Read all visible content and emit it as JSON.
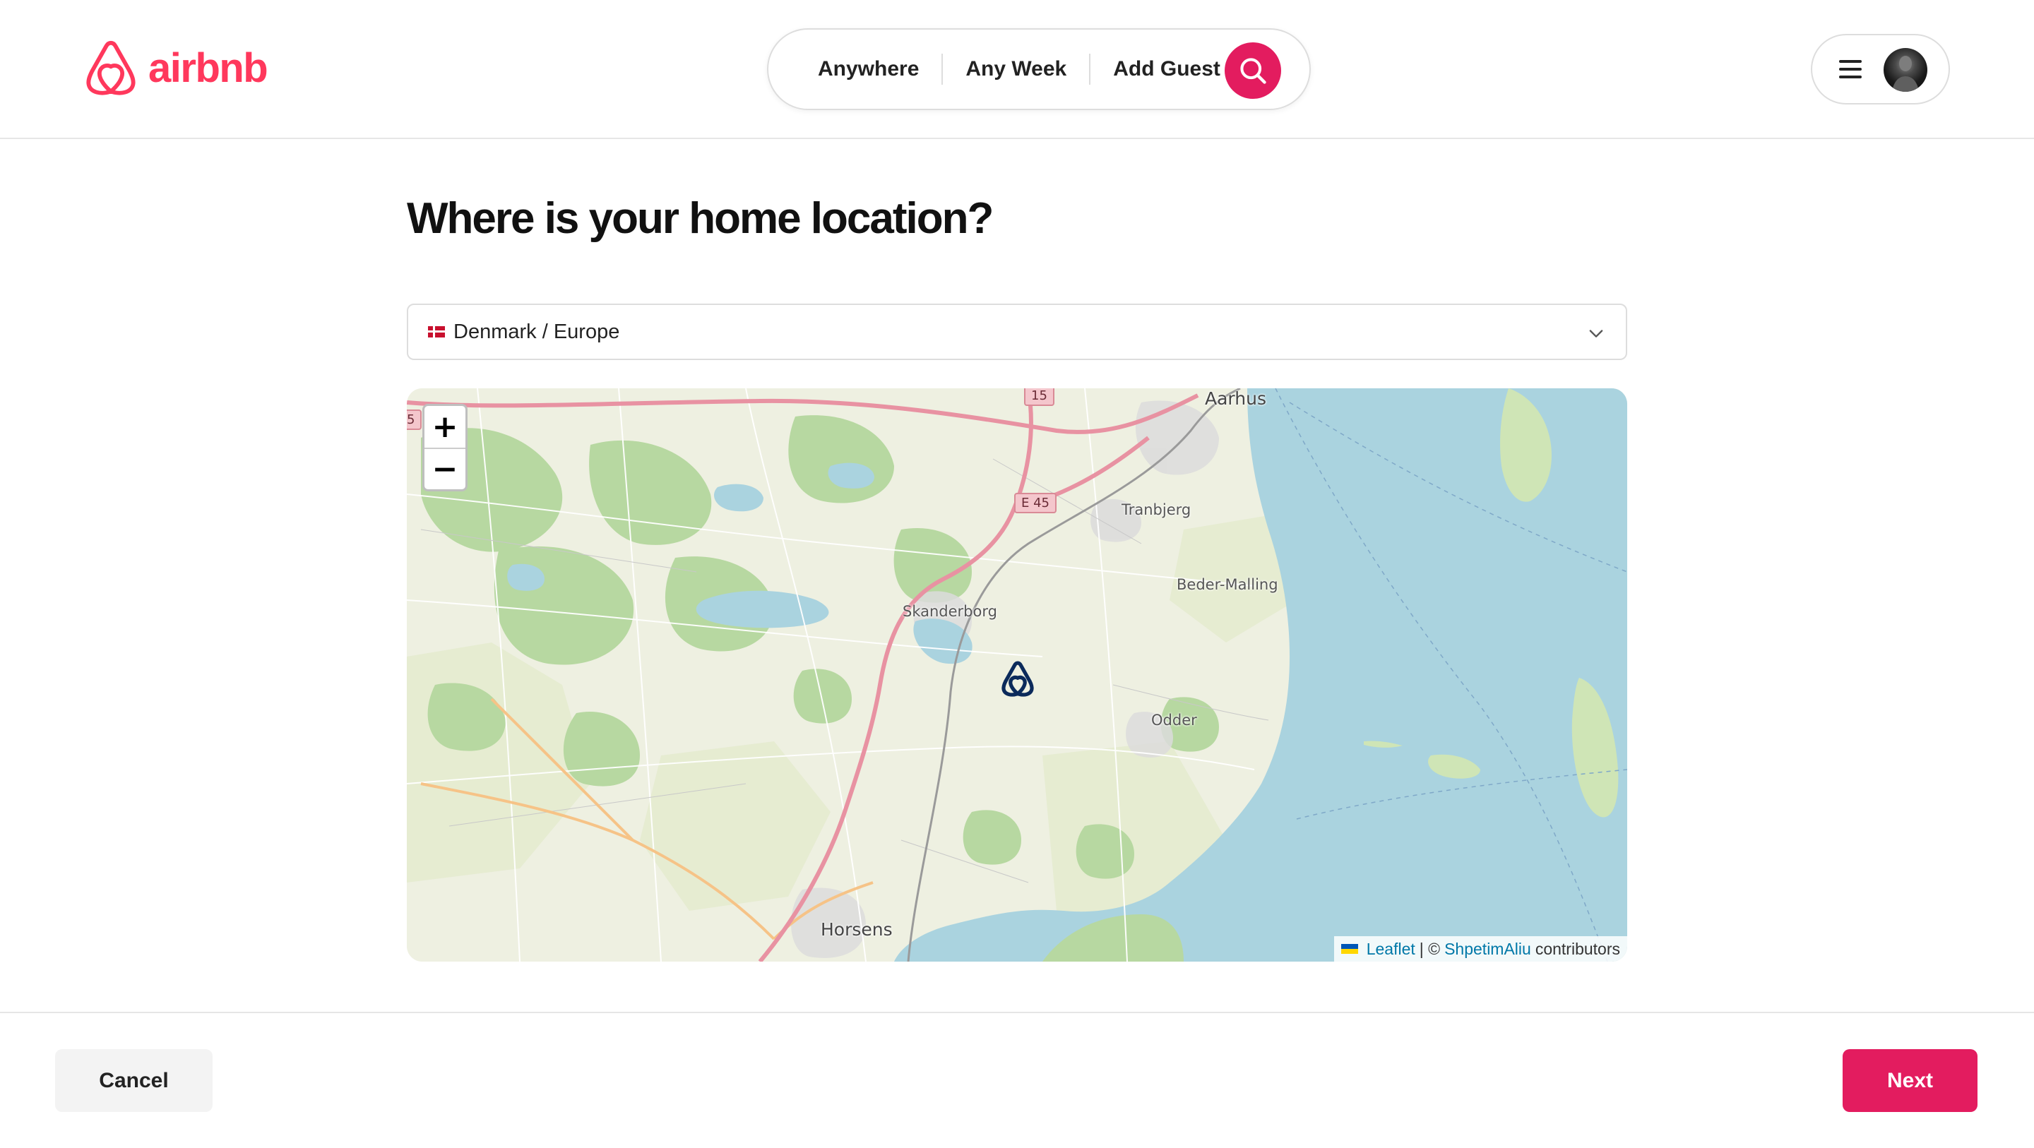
{
  "brand": {
    "name": "airbnb",
    "color": "#ff385c"
  },
  "search": {
    "location": "Anywhere",
    "week": "Any Week",
    "guests": "Add Guest",
    "button_color": "#e31c5f",
    "icon": "search-icon"
  },
  "user_menu": {
    "menu_icon": "hamburger-icon",
    "avatar": "avatar"
  },
  "main": {
    "title": "Where is your home location?",
    "location_select": {
      "value": "Denmark / Europe",
      "flag": "denmark-flag",
      "icon": "chevron-down-icon"
    }
  },
  "map": {
    "zoom_in": "+",
    "zoom_out": "−",
    "labels": {
      "aarhus": "Aarhus",
      "tranbjerg": "Tranbjerg",
      "beder_malling": "Beder-Malling",
      "skanderborg": "Skanderborg",
      "odder": "Odder",
      "horsens": "Horsens"
    },
    "roads": {
      "r15": "15",
      "e45": "E 45",
      "r5": "5"
    },
    "marker_icon": "airbnb-marker-icon",
    "attribution": {
      "leaflet": "Leaflet",
      "separator": "| ©",
      "author": "ShpetimAliu",
      "suffix": "contributors"
    }
  },
  "footer": {
    "cancel": "Cancel",
    "next": "Next"
  }
}
